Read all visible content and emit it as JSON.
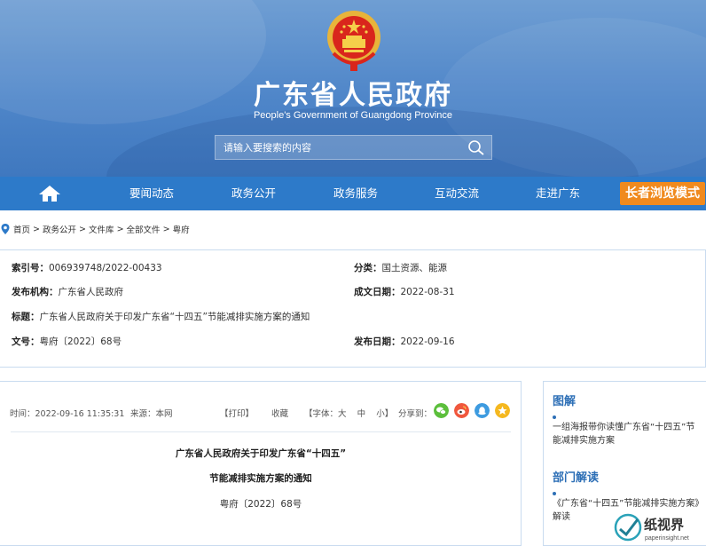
{
  "header": {
    "title": "广东省人民政府",
    "subtitle": "People's Government of Guangdong Province",
    "search_placeholder": "请输入要搜索的内容"
  },
  "nav": {
    "items": [
      "要闻动态",
      "政务公开",
      "政务服务",
      "互动交流",
      "走进广东"
    ],
    "elder_mode": "长者浏览模式"
  },
  "breadcrumb": [
    "首页",
    "政务公开",
    "文件库",
    "全部文件",
    "粤府"
  ],
  "meta": {
    "index_label": "索引号：",
    "index_value": "006939748/2022-00433",
    "category_label": "分类：",
    "category_value": "国土资源、能源",
    "issuer_label": "发布机构：",
    "issuer_value": "广东省人民政府",
    "created_label": "成文日期：",
    "created_value": "2022-08-31",
    "title_label": "标题：",
    "title_value": "广东省人民政府关于印发广东省“十四五”节能减排实施方案的通知",
    "docno_label": "文号：",
    "docno_value": "粤府〔2022〕68号",
    "published_label": "发布日期：",
    "published_value": "2022-09-16"
  },
  "article": {
    "time": "时间：2022-09-16 11:35:31",
    "source": "来源：本网",
    "print": "【打印】",
    "favorite": "收藏",
    "font_label": "【字体：",
    "font_large": "大",
    "font_medium": "中",
    "font_small": "小",
    "font_close": "】",
    "share_label": "分享到：",
    "title_line1": "广东省人民政府关于印发广东省“十四五”",
    "title_line2": "节能减排实施方案的通知",
    "doc_number": "粤府〔2022〕68号"
  },
  "sidebar": {
    "section1_title": "图解",
    "section1_link": "一组海报带你读懂广东省“十四五”节能减排实施方案",
    "section2_title": "部门解读",
    "section2_link": "《广东省“十四五”节能减排实施方案》解读"
  },
  "watermark": {
    "brand": "纸视界",
    "url": "paperinsight.net"
  },
  "colors": {
    "nav": "#2d7ac9",
    "accent_orange": "#f08a1e",
    "link_blue": "#2d6fb6"
  }
}
